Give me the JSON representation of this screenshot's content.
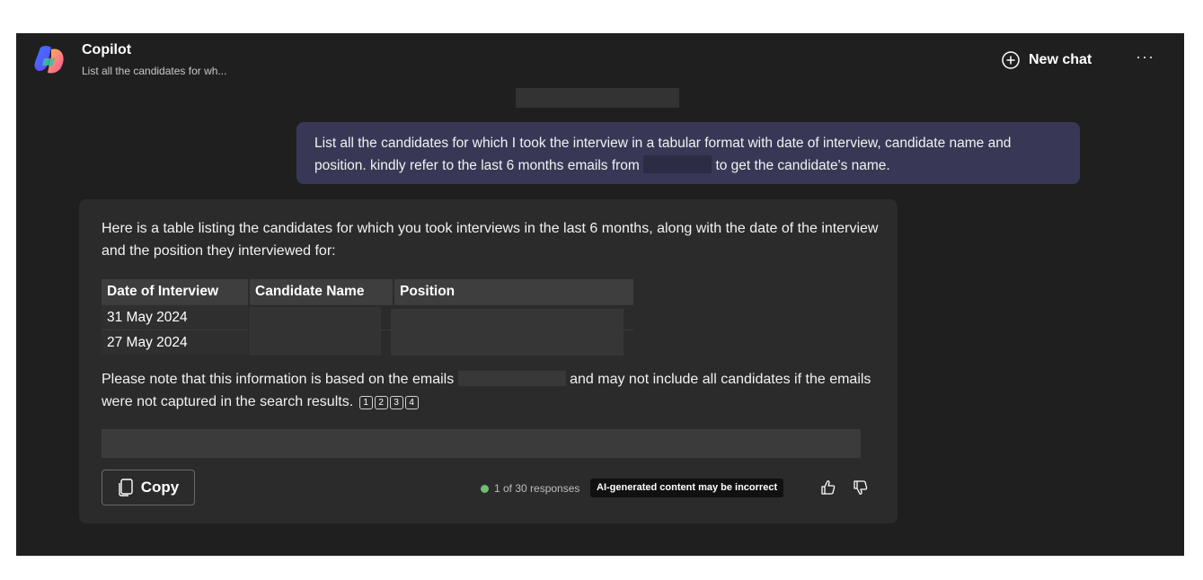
{
  "header": {
    "title": "Copilot",
    "subtitle": "List all the candidates for wh...",
    "new_chat_label": "New chat",
    "more_label": "···"
  },
  "user_message": {
    "part1": "List all the candidates for which I took the interview in a tabular format with date of interview, candidate name and position. kindly refer to the last 6 months emails from ",
    "part2": " to get the candidate's name."
  },
  "response": {
    "intro": "Here is a table listing the candidates for which you took interviews in the last 6 months, along with the date of the interview and the position they interviewed for:",
    "table": {
      "headers": [
        "Date of Interview",
        "Candidate Name",
        "Position"
      ],
      "rows": [
        {
          "date": "31 May 2024",
          "name": "",
          "position": ""
        },
        {
          "date": "27 May 2024",
          "name": "",
          "position": ""
        }
      ]
    },
    "note_part1": "Please note that this information is based on the emails ",
    "note_part2": " and may not include all candidates if the emails were not captured in the search results.",
    "citations": [
      "1",
      "2",
      "3",
      "4"
    ],
    "copy_label": "Copy",
    "response_count": "1 of 30 responses",
    "disclaimer": "AI-generated content may be incorrect"
  },
  "colors": {
    "background": "#1f1f1f",
    "user_bubble": "#383856",
    "card": "#2b2b2b",
    "status_dot": "#6fbf73"
  },
  "icons": [
    "copilot-logo",
    "new-chat-icon",
    "more-icon",
    "copy-icon",
    "thumbs-up-icon",
    "thumbs-down-icon"
  ]
}
